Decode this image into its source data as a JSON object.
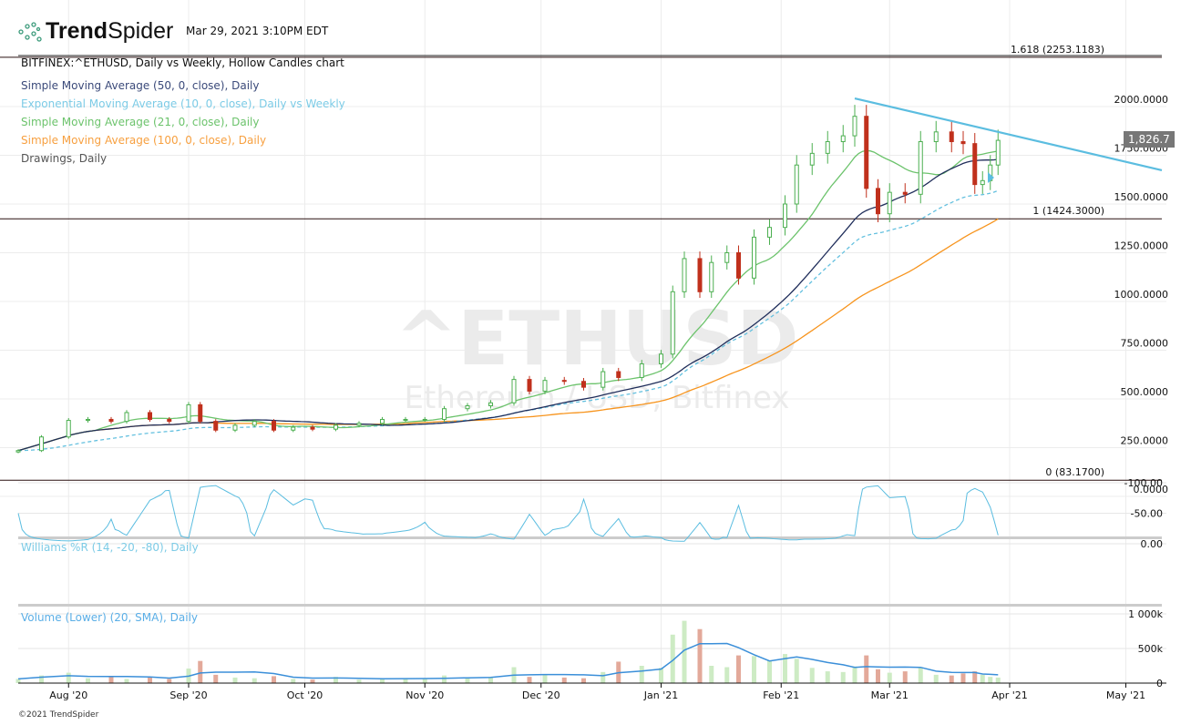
{
  "header": {
    "brand_bold": "Trend",
    "brand_light": "Spider",
    "timestamp": "Mar 29, 2021 3:10PM EDT",
    "chart_title": "BITFINEX:^ETHUSD, Daily vs Weekly, Hollow Candles chart",
    "copyright": "©2021 TrendSpider"
  },
  "legend": [
    {
      "label": "Simple Moving Average (50, 0, close), Daily",
      "color": "#3b4a7a"
    },
    {
      "label": "Exponential Moving Average (10, 0, close), Daily vs Weekly",
      "color": "#7ccbe6"
    },
    {
      "label": "Simple Moving Average (21, 0, close), Daily",
      "color": "#6cc36c"
    },
    {
      "label": "Simple Moving Average (100, 0, close), Daily",
      "color": "#f7a040"
    },
    {
      "label": "Drawings, Daily",
      "color": "#555555"
    }
  ],
  "watermark": {
    "symbol": "^ETHUSD",
    "name": "Ethereum / USD, Bitfinex"
  },
  "current_price": "1,826.7",
  "chart_data": {
    "type": "candlestick",
    "price_axis": {
      "ticks": [
        "2000.0000",
        "1750.0000",
        "1500.0000",
        "1250.0000",
        "1000.0000",
        "750.0000",
        "500.0000",
        "250.0000",
        "0.0000"
      ],
      "ylim": [
        0,
        2000
      ]
    },
    "x_ticks": [
      {
        "label": "Aug '20",
        "date": "2020-08-01"
      },
      {
        "label": "Sep '20",
        "date": "2020-09-01"
      },
      {
        "label": "Oct '20",
        "date": "2020-10-01"
      },
      {
        "label": "Nov '20",
        "date": "2020-11-01"
      },
      {
        "label": "Dec '20",
        "date": "2020-12-01"
      },
      {
        "label": "Jan '21",
        "date": "2021-01-01"
      },
      {
        "label": "Feb '21",
        "date": "2021-02-01"
      },
      {
        "label": "Mar '21",
        "date": "2021-03-01"
      },
      {
        "label": "Apr '21",
        "date": "2021-04-01"
      },
      {
        "label": "May '21",
        "date": "2021-05-01"
      }
    ],
    "fib_levels": [
      {
        "label": "1.618 (2253.1183)",
        "value": 2253.1183
      },
      {
        "label": "1 (1424.3000)",
        "value": 1424.3
      },
      {
        "label": "0 (83.1700)",
        "value": 83.17
      }
    ],
    "trendline": {
      "from": {
        "date": "2021-02-20",
        "price": 2042
      },
      "to": {
        "date": "2021-05-12",
        "price": 1673
      }
    },
    "dates": [
      "2020-07-19",
      "2020-07-25",
      "2020-08-01",
      "2020-08-06",
      "2020-08-12",
      "2020-08-16",
      "2020-08-22",
      "2020-08-27",
      "2020-09-01",
      "2020-09-04",
      "2020-09-08",
      "2020-09-13",
      "2020-09-18",
      "2020-09-23",
      "2020-09-28",
      "2020-10-03",
      "2020-10-09",
      "2020-10-15",
      "2020-10-21",
      "2020-10-27",
      "2020-11-01",
      "2020-11-06",
      "2020-11-12",
      "2020-11-18",
      "2020-11-24",
      "2020-11-28",
      "2020-12-02",
      "2020-12-07",
      "2020-12-12",
      "2020-12-17",
      "2020-12-21",
      "2020-12-27",
      "2021-01-01",
      "2021-01-04",
      "2021-01-07",
      "2021-01-11",
      "2021-01-14",
      "2021-01-18",
      "2021-01-21",
      "2021-01-25",
      "2021-01-29",
      "2021-02-02",
      "2021-02-05",
      "2021-02-09",
      "2021-02-13",
      "2021-02-17",
      "2021-02-20",
      "2021-02-23",
      "2021-02-26",
      "2021-03-01",
      "2021-03-05",
      "2021-03-09",
      "2021-03-13",
      "2021-03-17",
      "2021-03-20",
      "2021-03-23",
      "2021-03-25",
      "2021-03-27",
      "2021-03-29"
    ],
    "close": [
      235,
      305,
      390,
      395,
      385,
      430,
      395,
      385,
      470,
      385,
      340,
      365,
      385,
      340,
      355,
      345,
      365,
      375,
      395,
      395,
      395,
      450,
      465,
      480,
      600,
      540,
      595,
      590,
      560,
      640,
      610,
      680,
      730,
      1050,
      1220,
      1050,
      1200,
      1250,
      1120,
      1330,
      1380,
      1500,
      1700,
      1760,
      1820,
      1850,
      1950,
      1580,
      1450,
      1560,
      1550,
      1820,
      1870,
      1820,
      1810,
      1600,
      1620,
      1700,
      1826.7
    ],
    "volume_k": [
      60,
      110,
      150,
      70,
      90,
      60,
      80,
      60,
      210,
      320,
      120,
      80,
      70,
      100,
      60,
      50,
      90,
      50,
      60,
      70,
      60,
      110,
      80,
      90,
      230,
      90,
      130,
      80,
      70,
      160,
      310,
      250,
      220,
      700,
      900,
      780,
      250,
      230,
      400,
      390,
      330,
      420,
      350,
      220,
      170,
      160,
      240,
      400,
      200,
      150,
      170,
      220,
      120,
      110,
      140,
      170,
      120,
      90,
      80
    ],
    "indicators": {
      "williams": {
        "label": "Williams %R (14, -20, -80), Daily",
        "ticks": [
          "0.00",
          "-50.00",
          "-100.00"
        ],
        "band": [
          -20,
          -80
        ]
      },
      "volume": {
        "label": "Volume (Lower) (20, SMA), Daily",
        "ticks": [
          "1 000k",
          "500k",
          "0"
        ]
      }
    }
  }
}
